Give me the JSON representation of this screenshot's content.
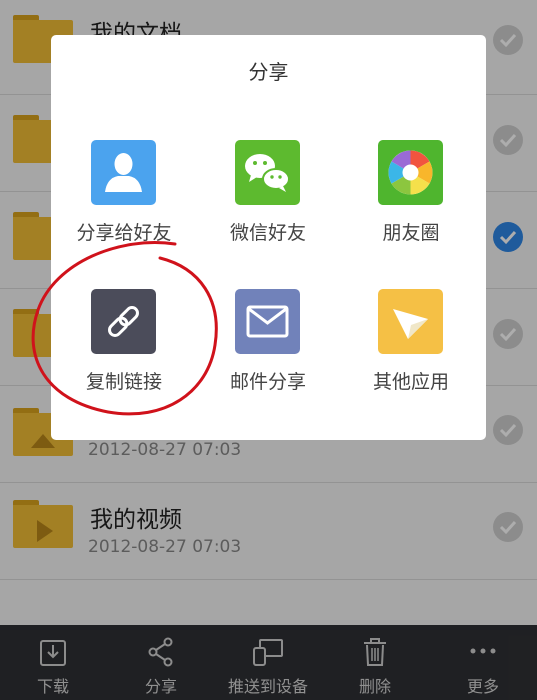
{
  "files": [
    {
      "name": "我的文档",
      "date": "",
      "checked": false,
      "icon": "doc-folder-icon"
    },
    {
      "name": "",
      "date": "",
      "checked": false,
      "icon": "folder-icon"
    },
    {
      "name": "",
      "date": "",
      "checked": true,
      "icon": "folder-icon"
    },
    {
      "name": "",
      "date": "",
      "checked": false,
      "icon": "folder-icon"
    },
    {
      "name": "",
      "date": "2012-08-27  07:03",
      "checked": false,
      "icon": "picture-folder-icon"
    },
    {
      "name": "我的视频",
      "date": "2012-08-27  07:03",
      "checked": false,
      "icon": "video-folder-icon"
    }
  ],
  "share_dialog": {
    "title": "分享",
    "items": [
      {
        "label": "分享给好友",
        "icon": "contact-icon",
        "color": "#4ba3ee"
      },
      {
        "label": "微信好友",
        "icon": "wechat-icon",
        "color": "#5dba2f"
      },
      {
        "label": "朋友圈",
        "icon": "moments-icon",
        "color": "#4fb52e"
      },
      {
        "label": "复制链接",
        "icon": "link-icon",
        "color": "#4b4c5a"
      },
      {
        "label": "邮件分享",
        "icon": "mail-icon",
        "color": "#7182ba"
      },
      {
        "label": "其他应用",
        "icon": "paper-plane-icon",
        "color": "#f5c045"
      }
    ]
  },
  "toolbar": {
    "items": [
      {
        "label": "下载",
        "icon": "download-icon"
      },
      {
        "label": "分享",
        "icon": "share-icon"
      },
      {
        "label": "推送到设备",
        "icon": "push-device-icon"
      },
      {
        "label": "删除",
        "icon": "trash-icon"
      },
      {
        "label": "更多",
        "icon": "more-icon"
      }
    ]
  },
  "colors": {
    "accent": "#2e87e6",
    "annotation": "#d0121b",
    "toolbar_bg": "#2f3034"
  }
}
